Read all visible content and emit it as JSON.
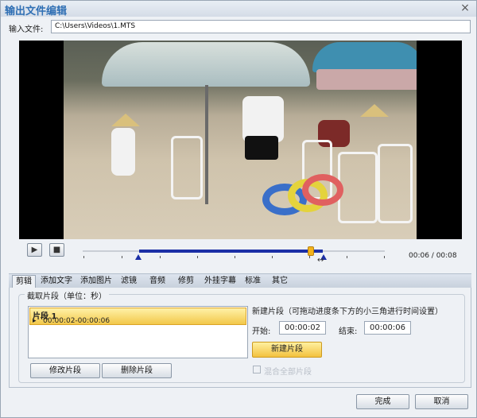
{
  "window": {
    "title": "输出文件编辑",
    "close_glyph": "×"
  },
  "input": {
    "label": "输入文件:",
    "value": "C:\\Users\\Videos\\1.MTS"
  },
  "playback": {
    "play_glyph": "▶",
    "stop_glyph": "■",
    "time": "00:06 / 00:08",
    "progress": 0.75,
    "selection_start": 0.25,
    "selection_end": 0.75
  },
  "tabs": [
    "剪辑",
    "添加文字",
    "添加图片",
    "滤镜",
    "音频",
    "修剪",
    "外挂字幕",
    "标准",
    "其它"
  ],
  "clip_section": {
    "group_label": "截取片段（单位：秒）",
    "clips": [
      {
        "name": "片段 1",
        "range": "00:00:02-00:00:06"
      }
    ],
    "modify_button": "修改片段",
    "delete_button": "删除片段"
  },
  "new_clip": {
    "title": "新建片段（可拖动进度条下方的小三角进行时间设置）",
    "start_label": "开始:",
    "start_value": "00:00:02",
    "end_label": "结束:",
    "end_value": "00:00:06",
    "button": "新建片段",
    "checkbox_label": "混合全部片段"
  },
  "footer": {
    "ok": "完成",
    "cancel": "取消"
  },
  "colors": {
    "accent": "#1b2fa6",
    "highlight": "#f3c23f",
    "title": "#2f6fb4"
  }
}
